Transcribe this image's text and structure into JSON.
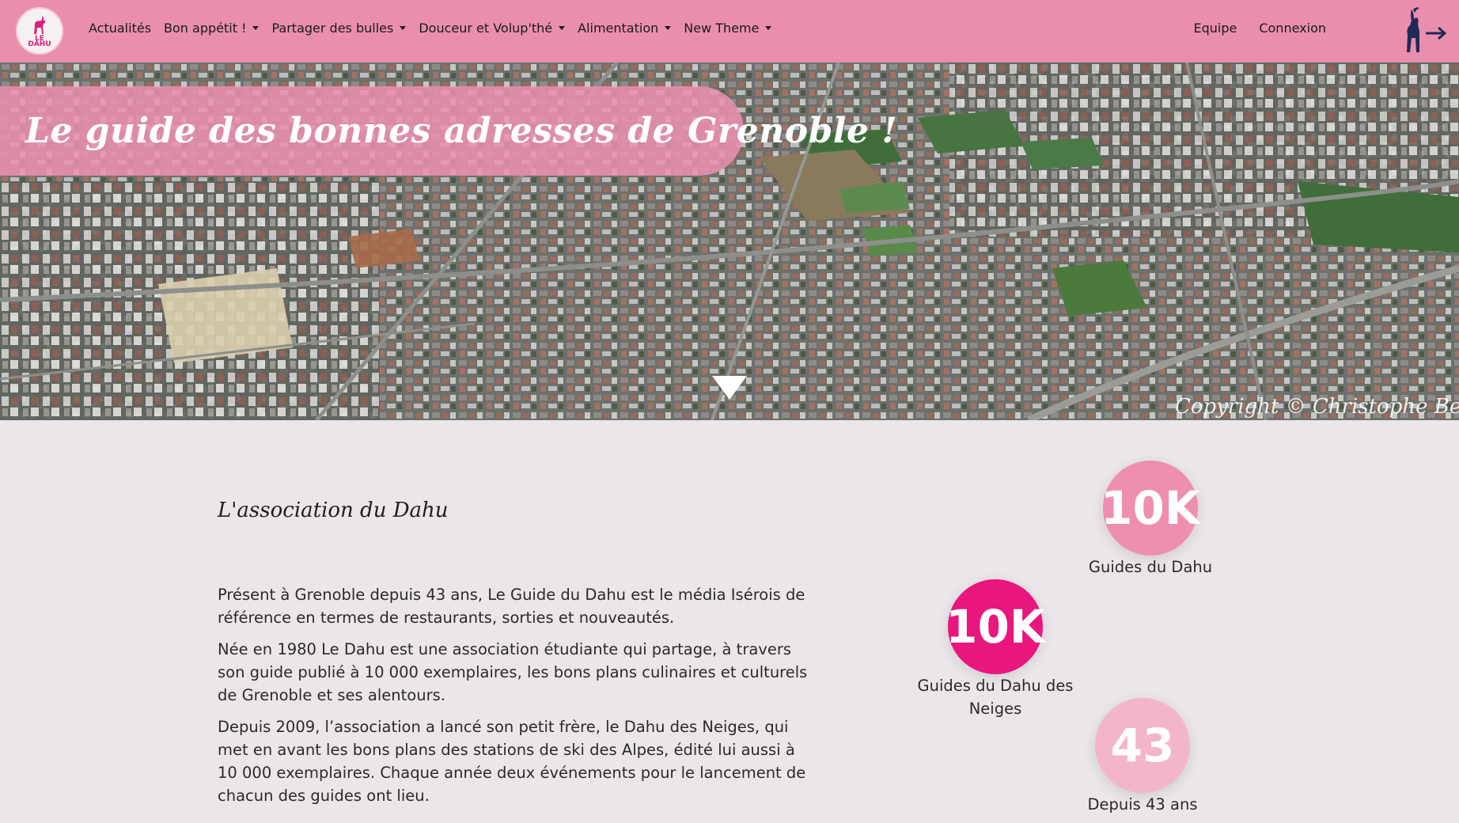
{
  "navbar": {
    "logo_text_line1": "LE",
    "logo_text_line2": "DAHU",
    "items": [
      {
        "label": "Actualités",
        "dropdown": false
      },
      {
        "label": "Bon appétit !",
        "dropdown": true
      },
      {
        "label": "Partager des bulles",
        "dropdown": true
      },
      {
        "label": "Douceur et Volup'thé",
        "dropdown": true
      },
      {
        "label": "Alimentation",
        "dropdown": true
      },
      {
        "label": "New Theme",
        "dropdown": true
      }
    ],
    "right_items": [
      {
        "label": "Equipe"
      },
      {
        "label": "Connexion"
      }
    ],
    "logout_icon": "goat-logout-icon",
    "background_color": "#e98fad"
  },
  "hero": {
    "title": "Le guide des bonnes adresses de Grenoble !",
    "copyright": "Copyright © Christophe Ben",
    "scroll_icon": "triangle-down-icon"
  },
  "about": {
    "title": "L'association du Dahu",
    "paragraphs": [
      "Présent à Grenoble depuis 43 ans, Le Guide du Dahu est le média Isérois de référence en termes de restaurants, sorties et nouveautés.",
      "Née en 1980 Le Dahu est une association étudiante qui partage, à travers son guide publié à 10 000 exemplaires, les bons plans culinaires et culturels de Grenoble et ses alentours.",
      "Depuis 2009, l’association a lancé son petit frère, le Dahu des Neiges, qui met en avant les bons plans des stations de ski des Alpes, édité lui aussi à 10 000 exemplaires. Chaque année deux événements pour le lancement de chacun des guides ont lieu."
    ]
  },
  "stats": [
    {
      "value": "10K",
      "label": "Guides du Dahu",
      "color": "#ee8fb0"
    },
    {
      "value": "10K",
      "label": "Guides du Dahu des Neiges",
      "color": "#e8167d"
    },
    {
      "value": "43",
      "label": "Depuis 43 ans",
      "color": "#f3b6c9"
    }
  ]
}
